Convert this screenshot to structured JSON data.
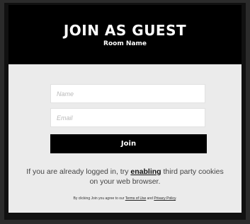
{
  "header": {
    "title": "JOIN AS GUEST",
    "subtitle": "Room Name"
  },
  "form": {
    "name_placeholder": "Name",
    "email_placeholder": "Email",
    "join_label": "Join"
  },
  "notice": {
    "prefix": "If you are already logged in, try",
    "link": "enabling",
    "suffix": "third party cookies on your web browser."
  },
  "terms": {
    "prefix": "By clicking Join you agree to our",
    "terms_link": "Terms of Use",
    "conjunction": "and",
    "privacy_link": "Privacy Policy",
    "suffix": "."
  },
  "colors": {
    "header_bg": "#000000",
    "body_bg": "#ebebeb",
    "button_bg": "#000000"
  }
}
